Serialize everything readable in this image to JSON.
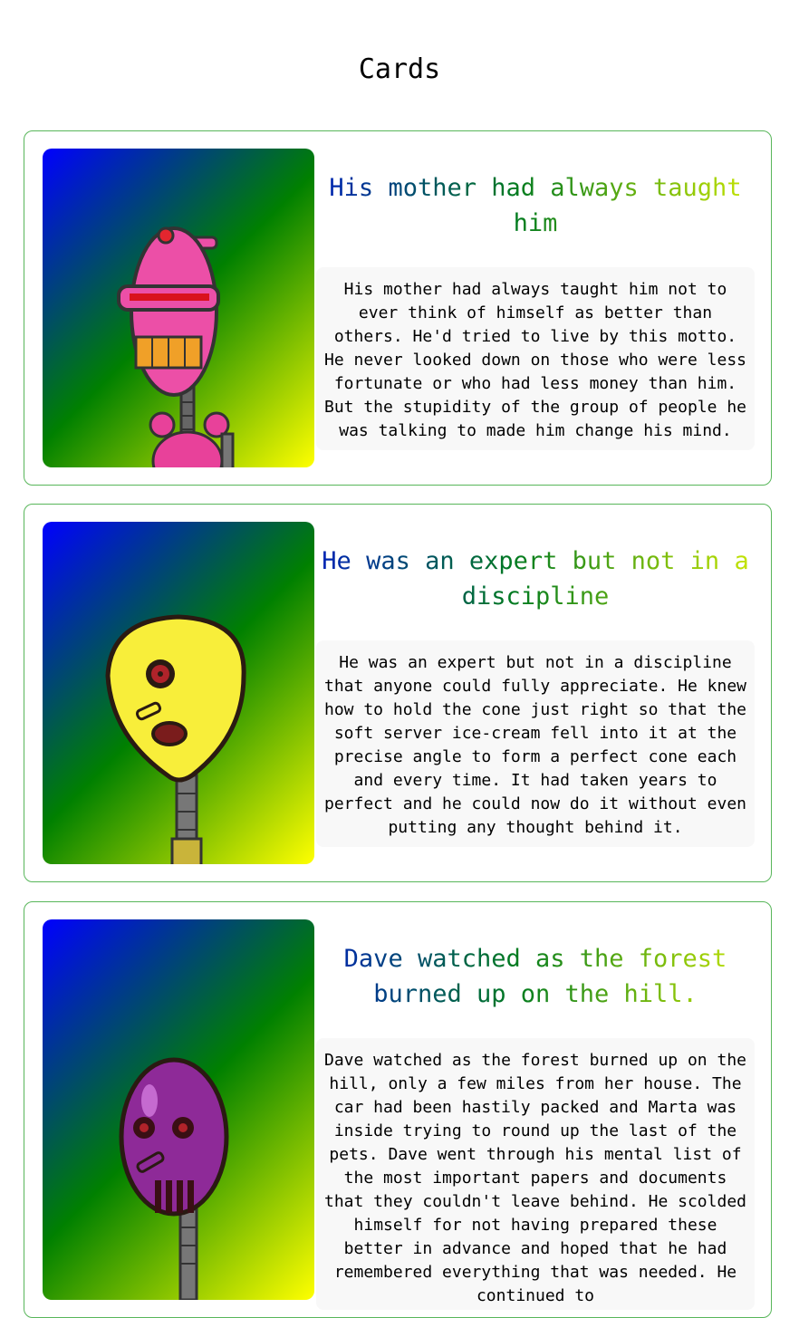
{
  "page": {
    "title": "Cards"
  },
  "cards": [
    {
      "title": "His mother had always taught him",
      "text": "His mother had always taught him not to ever think of himself as better than others. He'd tried to live by this motto. He never looked down on those who were less fortunate or who had less money than him. But the stupidity of the group of people he was talking to made him change his mind.",
      "image_icon": "pink-robot-image"
    },
    {
      "title": "He was an expert but not in a discipline",
      "text": "He was an expert but not in a discipline that anyone could fully appreciate. He knew how to hold the cone just right so that the soft server ice-cream fell into it at the precise angle to form a perfect cone each and every time. It had taken years to perfect and he could now do it without even putting any thought behind it.",
      "image_icon": "yellow-robot-image"
    },
    {
      "title": "Dave watched as the forest burned up on the hill.",
      "text": "Dave watched as the forest burned up on the hill, only a few miles from her house. The car had been hastily packed and Marta was inside trying to round up the last of the pets. Dave went through his mental list of the most important papers and documents that they couldn't leave behind. He scolded himself for not having prepared these better in advance and hoped that he had remembered everything that was needed. He continued to",
      "image_icon": "purple-robot-image"
    }
  ],
  "colors": {
    "border": "#58b65a",
    "text_bg": "#f8f8f8",
    "gradient": [
      "#0000ff",
      "#008000",
      "#ffff00"
    ]
  }
}
